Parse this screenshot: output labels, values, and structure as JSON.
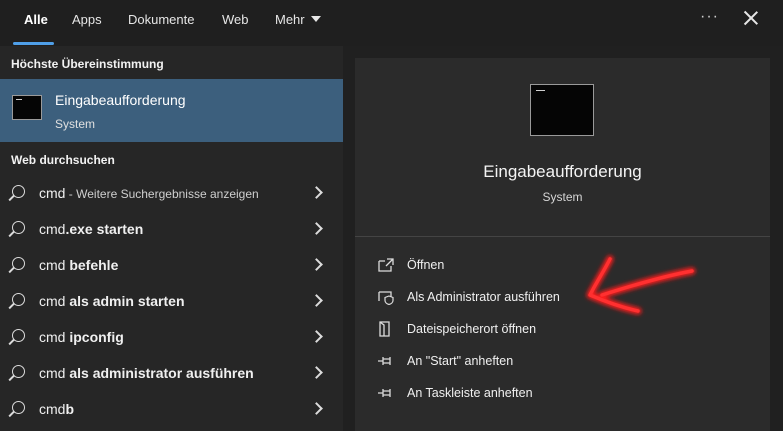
{
  "tabs": [
    {
      "label": "Alle",
      "active": true
    },
    {
      "label": "Apps"
    },
    {
      "label": "Dokumente"
    },
    {
      "label": "Web"
    },
    {
      "label": "Mehr"
    }
  ],
  "window_controls": {
    "more": "···",
    "close_icon": "close-icon"
  },
  "left": {
    "best_match_heading": "Höchste Übereinstimmung",
    "best_match": {
      "title": "Eingabeaufforderung",
      "subtitle": "System",
      "icon": "command-prompt-icon"
    },
    "web_heading": "Web durchsuchen",
    "suggestions": [
      {
        "plain": "cmd",
        "bold": "",
        "extra": " - Weitere Suchergebnisse anzeigen"
      },
      {
        "plain": "cmd",
        "bold": ".exe starten",
        "extra": ""
      },
      {
        "plain": "cmd ",
        "bold": "befehle",
        "extra": ""
      },
      {
        "plain": "cmd ",
        "bold": "als admin starten",
        "extra": ""
      },
      {
        "plain": "cmd ",
        "bold": "ipconfig",
        "extra": ""
      },
      {
        "plain": "cmd ",
        "bold": "als administrator ausführen",
        "extra": ""
      },
      {
        "plain": "cmd",
        "bold": "b",
        "extra": ""
      }
    ]
  },
  "right": {
    "title": "Eingabeaufforderung",
    "subtitle": "System",
    "actions": [
      {
        "label": "Öffnen",
        "icon": "open-icon"
      },
      {
        "label": "Als Administrator ausführen",
        "icon": "shield-icon"
      },
      {
        "label": "Dateispeicherort öffnen",
        "icon": "file-location-icon"
      },
      {
        "label": "An \"Start\" anheften",
        "icon": "pin-icon"
      },
      {
        "label": "An Taskleiste anheften",
        "icon": "pin-icon"
      }
    ]
  },
  "colors": {
    "accent": "#4f9fe8",
    "selected": "#3c5f7d",
    "annotation": "#ff1a1a"
  }
}
